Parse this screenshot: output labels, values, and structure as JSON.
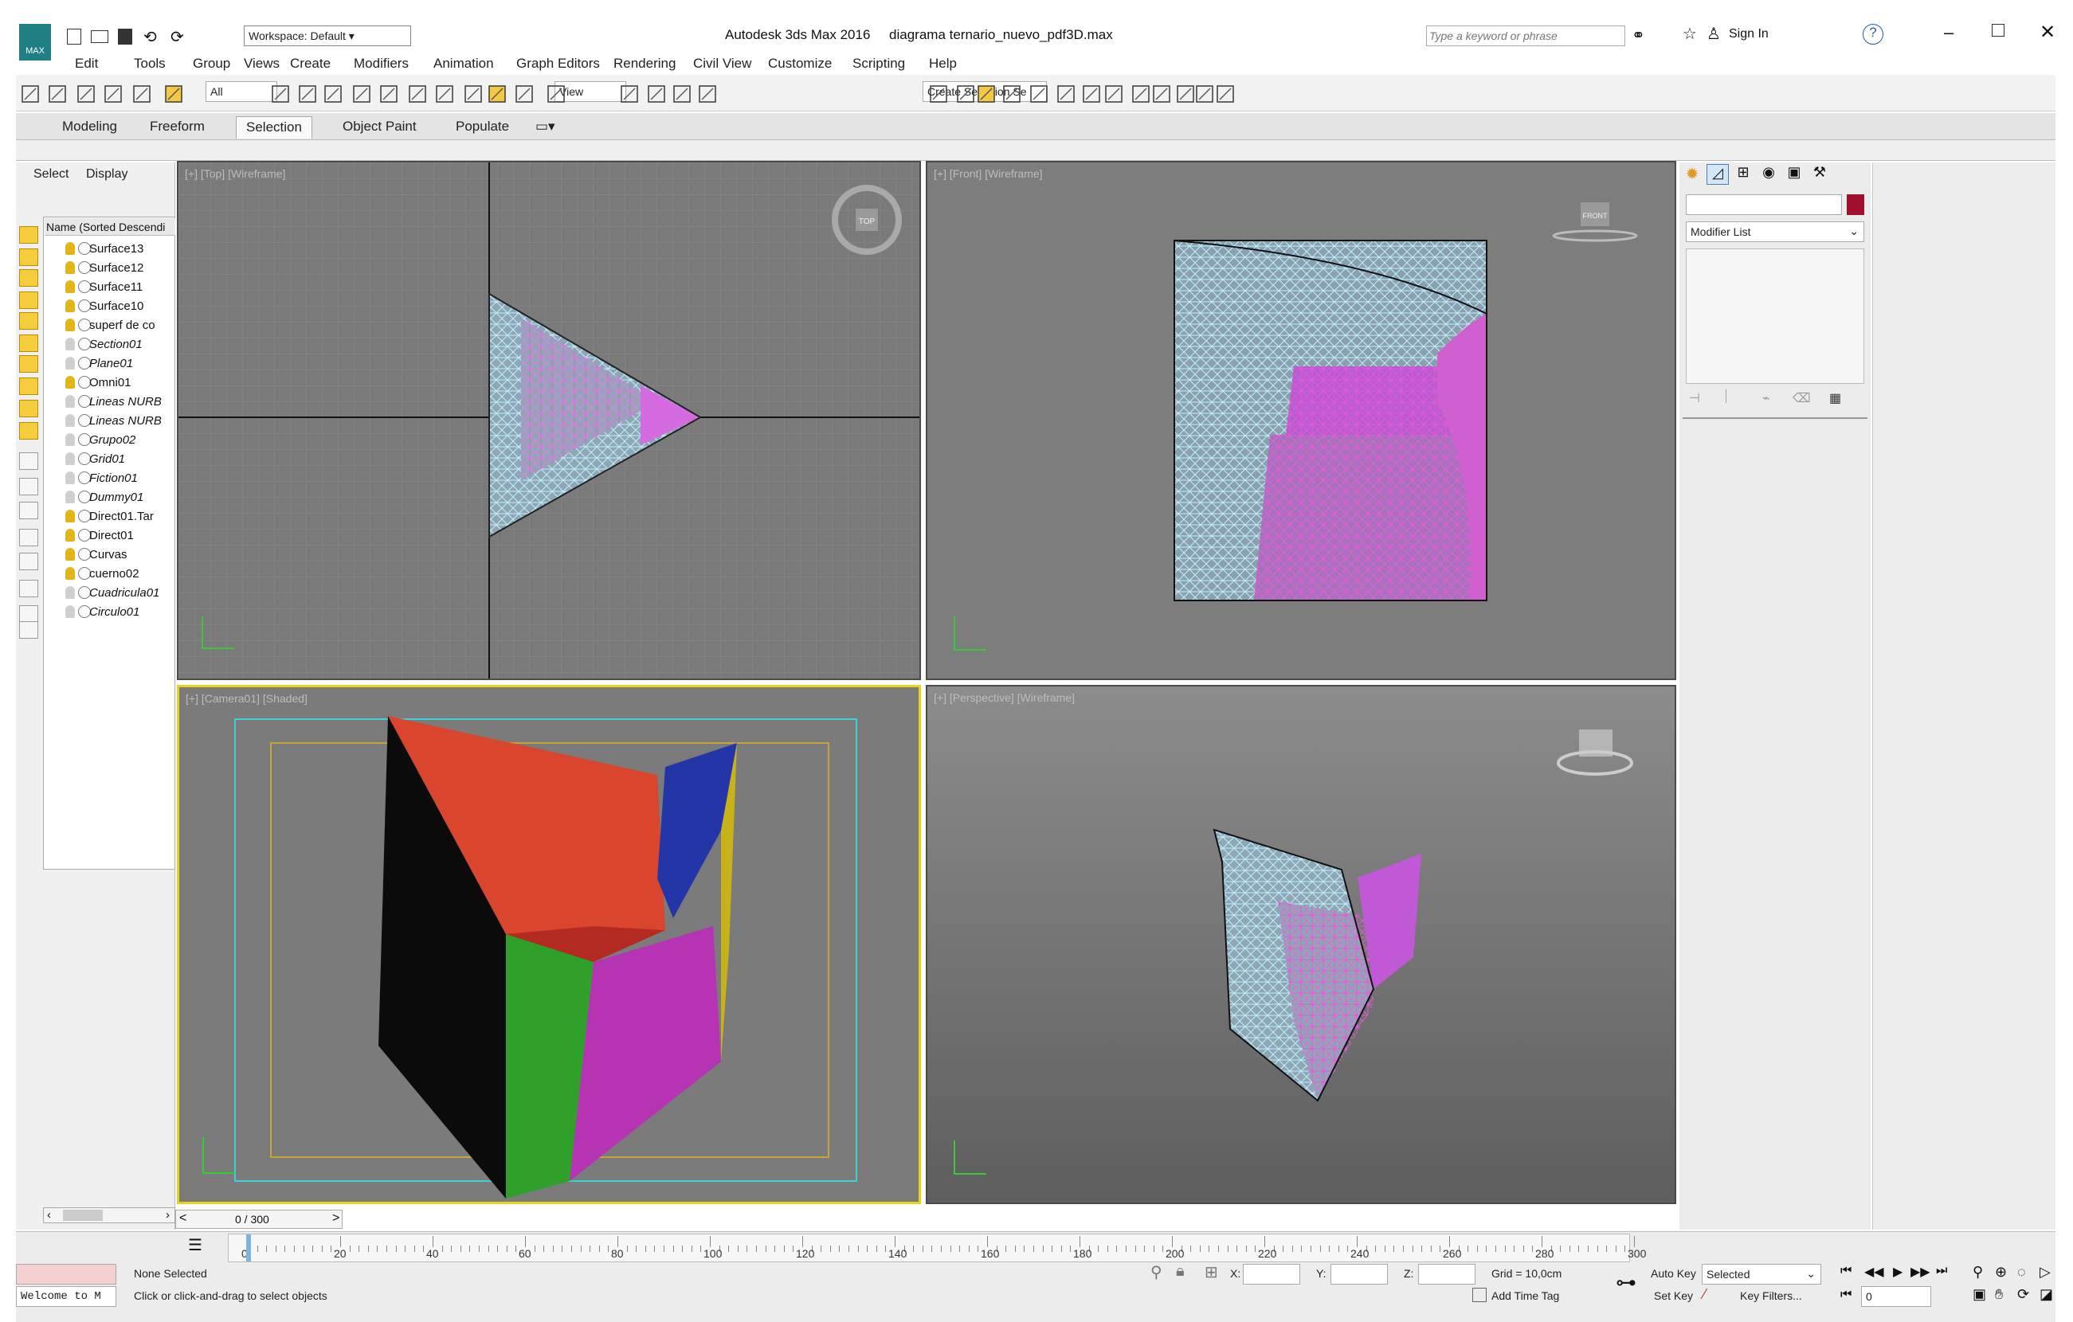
{
  "title": {
    "app": "Autodesk 3ds Max 2016",
    "file": "diagrama ternario_nuevo_pdf3D.max"
  },
  "workspace": "Workspace: Default",
  "search_placeholder": "Type a keyword or phrase",
  "sign_in": "Sign In",
  "menu": [
    "Edit",
    "Tools",
    "Group",
    "Views",
    "Create",
    "Modifiers",
    "Animation",
    "Graph Editors",
    "Rendering",
    "Civil View",
    "Customize",
    "Scripting",
    "Help"
  ],
  "toolbar": {
    "filter": "All",
    "view": "View",
    "selection_set": "Create Selection Se"
  },
  "ribbon_tabs": [
    "Modeling",
    "Freeform",
    "Selection",
    "Object Paint",
    "Populate"
  ],
  "scene": {
    "tabs": [
      "Select",
      "Display"
    ],
    "header": "Name (Sorted Descendi",
    "items": [
      {
        "name": "Surface13",
        "italic": false
      },
      {
        "name": "Surface12",
        "italic": false
      },
      {
        "name": "Surface11",
        "italic": false
      },
      {
        "name": "Surface10",
        "italic": false
      },
      {
        "name": "superf de co",
        "italic": false
      },
      {
        "name": "Section01",
        "italic": true
      },
      {
        "name": "Plane01",
        "italic": true
      },
      {
        "name": "Omni01",
        "italic": false
      },
      {
        "name": "Lineas NURB",
        "italic": true
      },
      {
        "name": "Lineas NURB",
        "italic": true
      },
      {
        "name": "Grupo02",
        "italic": true
      },
      {
        "name": "Grid01",
        "italic": true
      },
      {
        "name": "Fiction01",
        "italic": true
      },
      {
        "name": "Dummy01",
        "italic": true
      },
      {
        "name": "Direct01.Tar",
        "italic": false
      },
      {
        "name": "Direct01",
        "italic": false
      },
      {
        "name": "Curvas",
        "italic": false
      },
      {
        "name": "cuerno02",
        "italic": false
      },
      {
        "name": "Cuadricula01",
        "italic": true
      },
      {
        "name": "Circulo01",
        "italic": true
      }
    ]
  },
  "viewports": {
    "top": "[+] [Top] [Wireframe]",
    "front": "[+] [Front] [Wireframe]",
    "camera": "[+] [Camera01] [Shaded]",
    "persp": "[+] [Perspective] [Wireframe]",
    "cube_top": "TOP",
    "cube_front": "FRONT"
  },
  "colors": {
    "orange": "#d9452d",
    "black": "#0b0b0b",
    "green": "#2fa12b",
    "magenta": "#b633b4",
    "blue": "#2435a8",
    "yellow": "#c7b21a",
    "darkred": "#b22a20",
    "wire": "#b8e8f2",
    "pink": "#d548c8",
    "active": "#e8d21a"
  },
  "command_panel": {
    "modifier_list": "Modifier List"
  },
  "timeline": {
    "frame": "0 / 300",
    "ticks": [
      "0",
      "20",
      "40",
      "60",
      "80",
      "100",
      "120",
      "140",
      "160",
      "180",
      "200",
      "220",
      "240",
      "260",
      "280",
      "300"
    ]
  },
  "status": {
    "selection": "None Selected",
    "prompt": "Click or click-and-drag to select objects",
    "listener": "Welcome to M",
    "x": "X:",
    "y": "Y:",
    "z": "Z:",
    "grid": "Grid = 10,0cm",
    "add_time_tag": "Add Time Tag",
    "auto_key": "Auto Key",
    "set_key": "Set Key",
    "selected": "Selected",
    "key_filters": "Key Filters...",
    "frame_field": "0"
  }
}
